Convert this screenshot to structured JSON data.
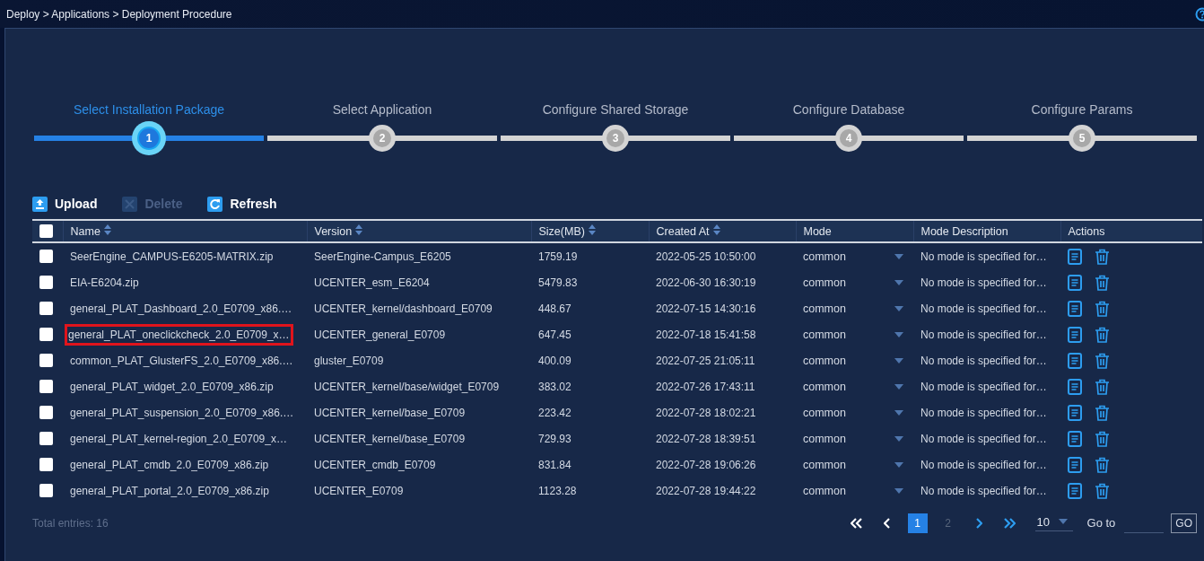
{
  "breadcrumb": "Deploy > Applications > Deployment Procedure",
  "steps": [
    {
      "number": "1",
      "label": "Select Installation Package",
      "selected": true
    },
    {
      "number": "2",
      "label": "Select Application",
      "selected": false
    },
    {
      "number": "3",
      "label": "Configure Shared Storage",
      "selected": false
    },
    {
      "number": "4",
      "label": "Configure Database",
      "selected": false
    },
    {
      "number": "5",
      "label": "Configure Params",
      "selected": false
    }
  ],
  "toolbar": [
    {
      "kind": "upload",
      "label": "Upload",
      "disabled": false
    },
    {
      "kind": "delete",
      "label": "Delete",
      "disabled": true
    },
    {
      "kind": "refresh",
      "label": "Refresh",
      "disabled": false
    }
  ],
  "table": {
    "columns": [
      {
        "label": "Name",
        "sortable": true
      },
      {
        "label": "Version",
        "sortable": true
      },
      {
        "label": "Size(MB)",
        "sortable": true
      },
      {
        "label": "Created At",
        "sortable": true
      },
      {
        "label": "Mode",
        "sortable": false
      },
      {
        "label": "Mode Description",
        "sortable": false
      },
      {
        "label": "Actions",
        "sortable": false
      }
    ],
    "header_checked": false,
    "rows": [
      {
        "checked": false,
        "highlighted": false,
        "name": "SeerEngine_CAMPUS-E6205-MATRIX.zip",
        "version": "SeerEngine-Campus_E6205",
        "size": "1759.19",
        "created": "2022-05-25 10:50:00",
        "mode": "common",
        "mode_description": "No mode is specified for…"
      },
      {
        "checked": false,
        "highlighted": false,
        "name": "EIA-E6204.zip",
        "version": "UCENTER_esm_E6204",
        "size": "5479.83",
        "created": "2022-06-30 16:30:19",
        "mode": "common",
        "mode_description": "No mode is specified for…"
      },
      {
        "checked": false,
        "highlighted": false,
        "name": "general_PLAT_Dashboard_2.0_E0709_x86.…",
        "version": "UCENTER_kernel/dashboard_E0709",
        "size": "448.67",
        "created": "2022-07-15 14:30:16",
        "mode": "common",
        "mode_description": "No mode is specified for…"
      },
      {
        "checked": false,
        "highlighted": true,
        "name": "general_PLAT_oneclickcheck_2.0_E0709_x…",
        "version": "UCENTER_general_E0709",
        "size": "647.45",
        "created": "2022-07-18 15:41:58",
        "mode": "common",
        "mode_description": "No mode is specified for…"
      },
      {
        "checked": false,
        "highlighted": false,
        "name": "common_PLAT_GlusterFS_2.0_E0709_x86.…",
        "version": "gluster_E0709",
        "size": "400.09",
        "created": "2022-07-25 21:05:11",
        "mode": "common",
        "mode_description": "No mode is specified for…"
      },
      {
        "checked": false,
        "highlighted": false,
        "name": "general_PLAT_widget_2.0_E0709_x86.zip",
        "version": "UCENTER_kernel/base/widget_E0709",
        "size": "383.02",
        "created": "2022-07-26 17:43:11",
        "mode": "common",
        "mode_description": "No mode is specified for…"
      },
      {
        "checked": false,
        "highlighted": false,
        "name": "general_PLAT_suspension_2.0_E0709_x86.…",
        "version": "UCENTER_kernel/base_E0709",
        "size": "223.42",
        "created": "2022-07-28 18:02:21",
        "mode": "common",
        "mode_description": "No mode is specified for…"
      },
      {
        "checked": false,
        "highlighted": false,
        "name": "general_PLAT_kernel-region_2.0_E0709_x…",
        "version": "UCENTER_kernel/base_E0709",
        "size": "729.93",
        "created": "2022-07-28 18:39:51",
        "mode": "common",
        "mode_description": "No mode is specified for…"
      },
      {
        "checked": false,
        "highlighted": false,
        "name": "general_PLAT_cmdb_2.0_E0709_x86.zip",
        "version": "UCENTER_cmdb_E0709",
        "size": "831.84",
        "created": "2022-07-28 19:06:26",
        "mode": "common",
        "mode_description": "No mode is specified for…"
      },
      {
        "checked": false,
        "highlighted": false,
        "name": "general_PLAT_portal_2.0_E0709_x86.zip",
        "version": "UCENTER_E0709",
        "size": "1123.28",
        "created": "2022-07-28 19:44:22",
        "mode": "common",
        "mode_description": "No mode is specified for…"
      }
    ]
  },
  "total": "Total entries: 16",
  "pagination": {
    "first_enabled": false,
    "prev_enabled": false,
    "next_enabled": true,
    "last_enabled": true,
    "pages": [
      {
        "label": "1",
        "selected": true
      },
      {
        "label": "2",
        "selected": false
      }
    ],
    "page_size": "10",
    "goto_label": "Go to",
    "go_button": "GO"
  }
}
